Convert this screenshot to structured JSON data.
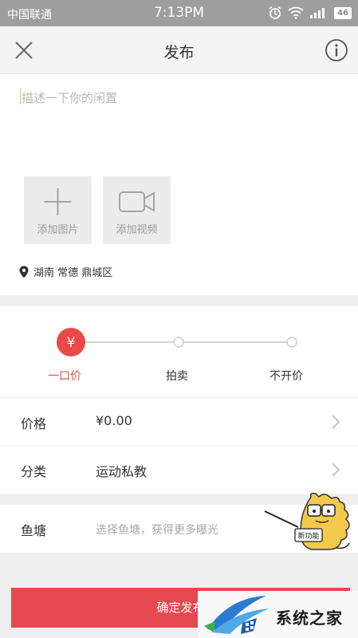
{
  "status_bar": {
    "carrier": "中国联通",
    "time": "7:13PM",
    "battery": "46"
  },
  "nav": {
    "title": "发布",
    "close_icon": "close-icon",
    "info_icon": "info-icon"
  },
  "post": {
    "description_placeholder": "描述一下你的闲置",
    "add_image_label": "添加图片",
    "add_video_label": "添加视频",
    "location": "湖南 常德 鼎城区"
  },
  "pricing": {
    "modes": [
      "一口价",
      "拍卖",
      "不开价"
    ],
    "selected_mode": "一口价",
    "currency_symbol": "¥",
    "accent_color": "#e94a47"
  },
  "fields": {
    "price_label": "价格",
    "price_value": "¥0.00",
    "category_label": "分类",
    "category_value": "运动私教"
  },
  "pond": {
    "label": "鱼塘",
    "placeholder": "选择鱼塘，获得更多曝光",
    "badge": "新功能"
  },
  "submit_label": "确定发布",
  "watermark": {
    "text": "系统之家"
  }
}
